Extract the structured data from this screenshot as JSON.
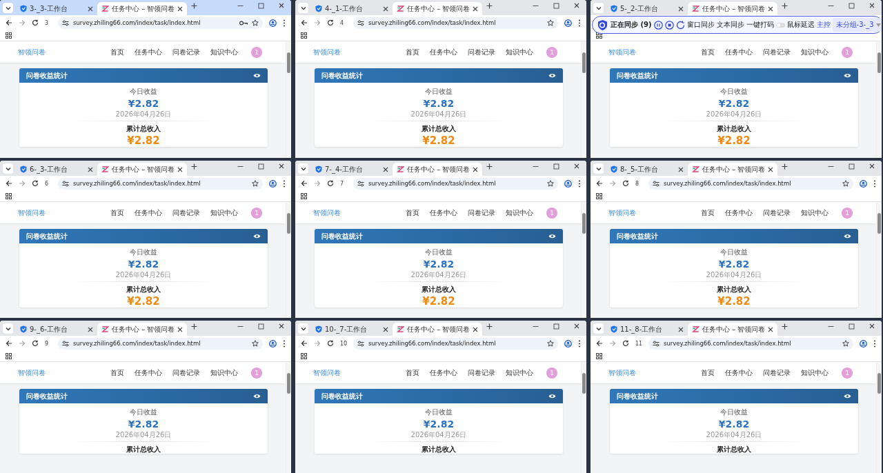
{
  "windows": [
    {
      "focused": true,
      "tabs": [
        {
          "title": "3-_3-工作台",
          "selected": false
        },
        {
          "title": "任务中心 – 智领问卷",
          "selected": true
        }
      ],
      "address_number": "3",
      "url": "survey.zhiling66.com/index/task/index.html",
      "saved_password": true,
      "site": {
        "logo": "智领问卷",
        "nav": [
          "首页",
          "任务中心",
          "问卷记录",
          "知识中心"
        ],
        "avatar": "1"
      },
      "card": {
        "title": "问卷收益统计",
        "today_label": "今日收益",
        "today_amount": "¥2.82",
        "date": "2026年04月26日",
        "total_label": "累计总收入",
        "total_amount": "¥2.82"
      }
    },
    {
      "focused": false,
      "tabs": [
        {
          "title": "4-_1-工作台",
          "selected": false
        },
        {
          "title": "任务中心 – 智领问卷",
          "selected": true
        }
      ],
      "address_number": "4",
      "url": "survey.zhiling66.com/index/task/index.html",
      "site": {
        "logo": "智领问卷",
        "nav": [
          "首页",
          "任务中心",
          "问卷记录",
          "知识中心"
        ],
        "avatar": "1"
      },
      "card": {
        "title": "问卷收益统计",
        "today_label": "今日收益",
        "today_amount": "¥2.82",
        "date": "2026年04月26日",
        "total_label": "累计总收入",
        "total_amount": "¥2.82"
      }
    },
    {
      "focused": false,
      "tabs": [
        {
          "title": "5-_2-工作台",
          "selected": false
        },
        {
          "title": "任务中心 – 智领问卷",
          "selected": true
        }
      ],
      "sync_bar": {
        "status": "正在同步 (9)",
        "actions": [
          "窗口同步",
          "文本同步",
          "一键打码"
        ],
        "toggle": {
          "label": "鼠标延迟",
          "on": false
        },
        "role": "主控",
        "group": "未分组-3-_3"
      },
      "site": {
        "logo": "智领问卷",
        "nav": [
          "首页",
          "任务中心",
          "问卷记录",
          "知识中心"
        ],
        "avatar": "1"
      },
      "card": {
        "title": "问卷收益统计",
        "today_label": "今日收益",
        "today_amount": "¥2.82",
        "date": "2026年04月26日",
        "total_label": "累计总收入",
        "total_amount": "¥2.82"
      }
    },
    {
      "focused": false,
      "tabs": [
        {
          "title": "6-_3-工作台",
          "selected": false
        },
        {
          "title": "任务中心 – 智领问卷",
          "selected": true
        }
      ],
      "address_number": "6",
      "url": "survey.zhiling66.com/index/task/index.html",
      "site": {
        "logo": "智领问卷",
        "nav": [
          "首页",
          "任务中心",
          "问卷记录",
          "知识中心"
        ],
        "avatar": "1"
      },
      "card": {
        "title": "问卷收益统计",
        "today_label": "今日收益",
        "today_amount": "¥2.82",
        "date": "2026年04月26日",
        "total_label": "累计总收入",
        "total_amount": "¥2.82"
      }
    },
    {
      "focused": false,
      "tabs": [
        {
          "title": "7-_4-工作台",
          "selected": false
        },
        {
          "title": "任务中心 – 智领问卷",
          "selected": true
        }
      ],
      "address_number": "7",
      "url": "survey.zhiling66.com/index/task/index.html",
      "site": {
        "logo": "智领问卷",
        "nav": [
          "首页",
          "任务中心",
          "问卷记录",
          "知识中心"
        ],
        "avatar": "1"
      },
      "card": {
        "title": "问卷收益统计",
        "today_label": "今日收益",
        "today_amount": "¥2.82",
        "date": "2026年04月26日",
        "total_label": "累计总收入",
        "total_amount": "¥2.82"
      }
    },
    {
      "focused": false,
      "tabs": [
        {
          "title": "8-_5-工作台",
          "selected": false
        },
        {
          "title": "任务中心 – 智领问卷",
          "selected": true
        }
      ],
      "address_number": "8",
      "url": "survey.zhiling66.com/index/task/index.html",
      "site": {
        "logo": "智领问卷",
        "nav": [
          "首页",
          "任务中心",
          "问卷记录",
          "知识中心"
        ],
        "avatar": "1"
      },
      "card": {
        "title": "问卷收益统计",
        "today_label": "今日收益",
        "today_amount": "¥2.82",
        "date": "2026年04月26日",
        "total_label": "累计总收入",
        "total_amount": "¥2.82"
      }
    },
    {
      "focused": false,
      "tabs": [
        {
          "title": "9-_6-工作台",
          "selected": false
        },
        {
          "title": "任务中心 – 智领问卷",
          "selected": true
        }
      ],
      "address_number": "9",
      "url": "survey.zhiling66.com/index/task/index.html",
      "site": {
        "logo": "智领问卷",
        "nav": [
          "首页",
          "任务中心",
          "问卷记录",
          "知识中心"
        ],
        "avatar": "1"
      },
      "card": {
        "title": "问卷收益统计",
        "today_label": "今日收益",
        "today_amount": "¥2.82",
        "date": "2026年04月26日",
        "total_label": "累计总收入"
      }
    },
    {
      "focused": false,
      "tabs": [
        {
          "title": "10-_7-工作台",
          "selected": false
        },
        {
          "title": "任务中心 – 智领问卷",
          "selected": true
        }
      ],
      "address_number": "10",
      "url": "survey.zhiling66.com/index/task/index.html",
      "site": {
        "logo": "智领问卷",
        "nav": [
          "首页",
          "任务中心",
          "问卷记录",
          "知识中心"
        ],
        "avatar": "1"
      },
      "card": {
        "title": "问卷收益统计",
        "today_label": "今日收益",
        "today_amount": "¥2.82",
        "date": "2026年04月26日",
        "total_label": "累计总收入"
      }
    },
    {
      "focused": false,
      "tabs": [
        {
          "title": "11-_8-工作台",
          "selected": false
        },
        {
          "title": "任务中心 – 智领问卷",
          "selected": true
        }
      ],
      "address_number": "11",
      "url": "survey.zhiling66.com/index/task/index.html",
      "site": {
        "logo": "智领问卷",
        "nav": [
          "首页",
          "任务中心",
          "问卷记录",
          "知识中心"
        ],
        "avatar": "1"
      },
      "card": {
        "title": "问卷收益统计",
        "today_label": "今日收益",
        "today_amount": "¥2.82",
        "date": "2026年04月26日",
        "total_label": "累计总收入"
      }
    }
  ]
}
